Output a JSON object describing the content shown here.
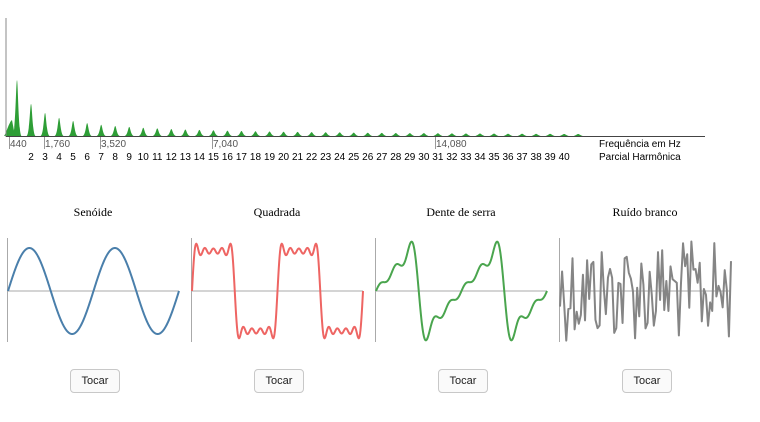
{
  "spectrum": {
    "frequency_label": "Frequência em Hz",
    "partial_label": "Parcial Harmônica",
    "frequency_ticks": [
      "440",
      "1,760",
      "3,520",
      "7,040",
      "14,080"
    ],
    "harmonics": [
      "2",
      "3",
      "4",
      "5",
      "6",
      "7",
      "8",
      "9",
      "10",
      "11",
      "12",
      "13",
      "14",
      "15",
      "16",
      "17",
      "18",
      "19",
      "20",
      "21",
      "22",
      "23",
      "24",
      "25",
      "26",
      "27",
      "28",
      "29",
      "30",
      "31",
      "32",
      "33",
      "34",
      "35",
      "36",
      "37",
      "38",
      "39",
      "40"
    ],
    "fill_color": "#2e9e36"
  },
  "waveforms": [
    {
      "title": "Senóide",
      "button": "Tocar",
      "color": "#4a7fab",
      "type": "sine"
    },
    {
      "title": "Quadrada",
      "button": "Tocar",
      "color": "#ee6563",
      "type": "square"
    },
    {
      "title": "Dente de serra",
      "button": "Tocar",
      "color": "#4aa54e",
      "type": "sawtooth"
    },
    {
      "title": "Ruído branco",
      "button": "Tocar",
      "color": "#858585",
      "type": "noise"
    }
  ]
}
